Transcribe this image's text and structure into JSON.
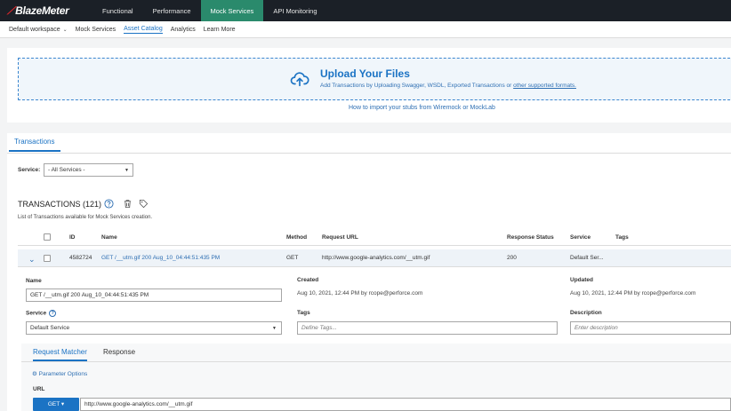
{
  "topbar": {
    "logo": "BlazeMeter",
    "tabs": [
      {
        "label": "Functional"
      },
      {
        "label": "Performance"
      },
      {
        "label": "Mock Services"
      },
      {
        "label": "API Monitoring"
      }
    ],
    "active_tab": "Mock Services"
  },
  "subnav": {
    "workspace": "Default workspace",
    "items": [
      {
        "label": "Mock Services"
      },
      {
        "label": "Asset Catalog"
      },
      {
        "label": "Analytics"
      },
      {
        "label": "Learn More"
      }
    ],
    "active_item": "Asset Catalog"
  },
  "upload": {
    "title": "Upload Your Files",
    "subtitle_prefix": "Add Transactions by Uploading Swagger, WSDL, Exported Transactions or ",
    "subtitle_link": "other supported formats.",
    "howto": "How to import your stubs from Wiremock or MockLab"
  },
  "tabs": {
    "transactions": "Transactions"
  },
  "filter": {
    "service_label": "Service:",
    "service_value": "- All Services -"
  },
  "transactions": {
    "title": "TRANSACTIONS (121)",
    "description": "List of Transactions available for Mock Services creation.",
    "columns": {
      "id": "ID",
      "name": "Name",
      "method": "Method",
      "request_url": "Request URL",
      "response_status": "Response Status",
      "service": "Service",
      "tags": "Tags"
    },
    "selected_row": {
      "id": "4582724",
      "name": "GET /__utm.gif 200 Aug_10_04:44:51:435 PM",
      "method": "GET",
      "request_url": "http://www.google-analytics.com/__utm.gif",
      "response_status": "200",
      "service": "Default Ser..."
    }
  },
  "detail": {
    "name_label": "Name",
    "name_value": "GET /__utm.gif 200 Aug_10_04:44:51:435 PM",
    "created_label": "Created",
    "created_value": "Aug 10, 2021, 12:44 PM by rcope@perforce.com",
    "updated_label": "Updated",
    "updated_value": "Aug 10, 2021, 12:44 PM by rcope@perforce.com",
    "service_label": "Service",
    "service_value": "Default Service",
    "tags_label": "Tags",
    "tags_placeholder": "Define Tags...",
    "description_label": "Description",
    "description_placeholder": "Enter description"
  },
  "matcher": {
    "tabs": [
      {
        "label": "Request Matcher"
      },
      {
        "label": "Response"
      }
    ],
    "active_tab": "Request Matcher",
    "param_options": "Parameter Options",
    "url_label": "URL",
    "method_button": "GET",
    "url_value": "http://www.google-analytics.com/__utm.gif"
  },
  "colors": {
    "topbar_bg": "#1b2027",
    "active_tab_bg": "#2a8a6c",
    "accent": "#1b73c4",
    "brand_red": "#e3262a"
  },
  "icons": [
    "upload-cloud-icon",
    "help-icon",
    "trash-icon",
    "tag-icon",
    "chevron-down-icon",
    "checkbox-icon"
  ]
}
